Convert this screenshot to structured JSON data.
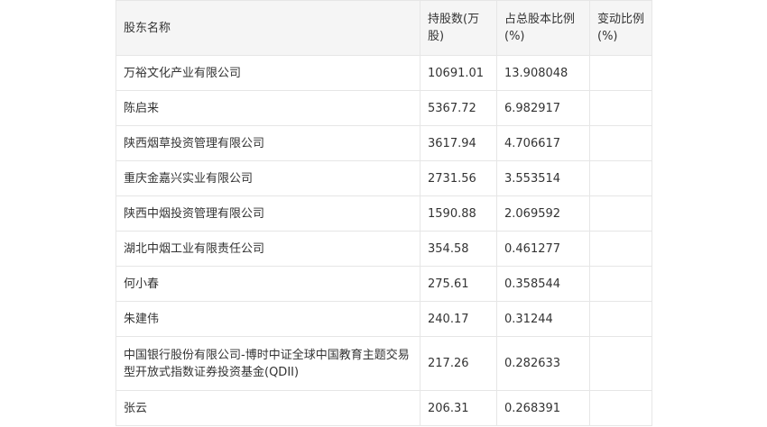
{
  "table": {
    "headers": [
      "股东名称",
      "持股数(万股)",
      "占总股本比例(%)",
      "变动比例(%)"
    ],
    "rows": [
      {
        "name": "万裕文化产业有限公司",
        "shares": "10691.01",
        "ratio": "13.908048",
        "change": ""
      },
      {
        "name": "陈启来",
        "shares": "5367.72",
        "ratio": "6.982917",
        "change": ""
      },
      {
        "name": "陕西烟草投资管理有限公司",
        "shares": "3617.94",
        "ratio": "4.706617",
        "change": ""
      },
      {
        "name": "重庆金嘉兴实业有限公司",
        "shares": "2731.56",
        "ratio": "3.553514",
        "change": ""
      },
      {
        "name": "陕西中烟投资管理有限公司",
        "shares": "1590.88",
        "ratio": "2.069592",
        "change": ""
      },
      {
        "name": "湖北中烟工业有限责任公司",
        "shares": "354.58",
        "ratio": "0.461277",
        "change": ""
      },
      {
        "name": "何小春",
        "shares": "275.61",
        "ratio": "0.358544",
        "change": ""
      },
      {
        "name": "朱建伟",
        "shares": "240.17",
        "ratio": "0.31244",
        "change": ""
      },
      {
        "name": "中国银行股份有限公司-博时中证全球中国教育主题交易型开放式指数证券投资基金(QDII)",
        "shares": "217.26",
        "ratio": "0.282633",
        "change": ""
      },
      {
        "name": "张云",
        "shares": "206.31",
        "ratio": "0.268391",
        "change": ""
      }
    ]
  }
}
